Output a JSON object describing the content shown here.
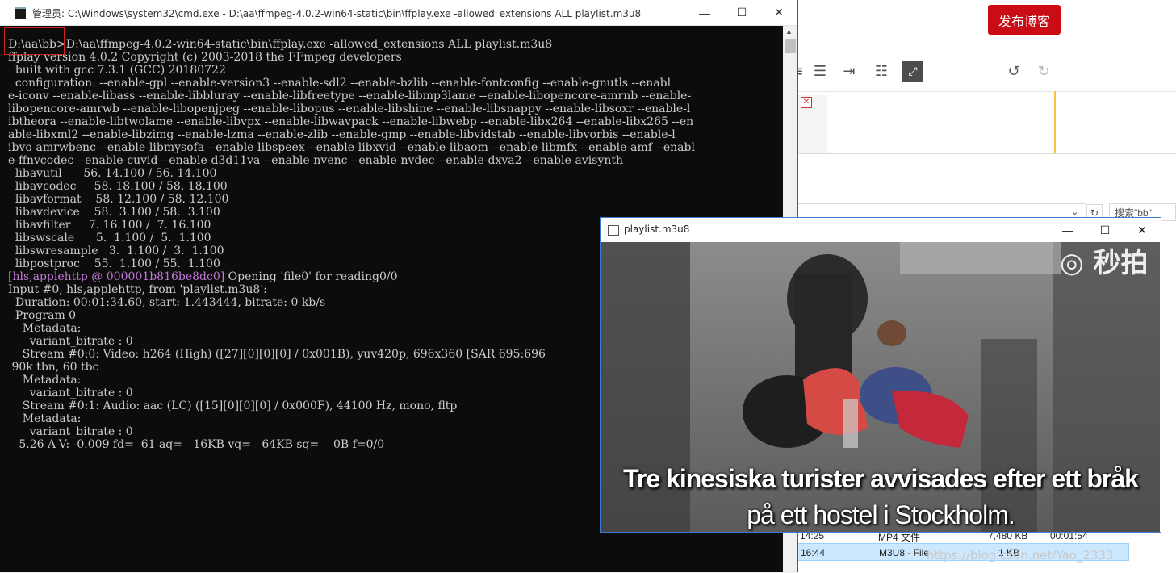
{
  "background_app": {
    "publish_button": "发布博客",
    "search_box": "搜索\"bb\"",
    "files": [
      {
        "time": "14:25",
        "type": "MP4 文件",
        "size": "7,480 KB",
        "duration": "00:01:54"
      },
      {
        "time": "16:44",
        "type": "M3U8 - File",
        "size": "1 KB",
        "duration": ""
      }
    ],
    "watermark": "https://blog.csdn.net/Yao_2333"
  },
  "cmd_window": {
    "title": "管理员: C:\\Windows\\system32\\cmd.exe - D:\\aa\\ffmpeg-4.0.2-win64-static\\bin\\ffplay.exe  -allowed_extensions ALL playlist.m3u8",
    "window_buttons": {
      "minimize": "—",
      "maximize": "☐",
      "close": "✕"
    },
    "lines": [
      "D:\\aa\\bb>D:\\aa\\ffmpeg-4.0.2-win64-static\\bin\\ffplay.exe -allowed_extensions ALL playlist.m3u8",
      "ffplay version 4.0.2 Copyright (c) 2003-2018 the FFmpeg developers",
      "  built with gcc 7.3.1 (GCC) 20180722",
      "  configuration: --enable-gpl --enable-version3 --enable-sdl2 --enable-bzlib --enable-fontconfig --enable-gnutls --enabl",
      "e-iconv --enable-libass --enable-libbluray --enable-libfreetype --enable-libmp3lame --enable-libopencore-amrnb --enable-",
      "libopencore-amrwb --enable-libopenjpeg --enable-libopus --enable-libshine --enable-libsnappy --enable-libsoxr --enable-l",
      "ibtheora --enable-libtwolame --enable-libvpx --enable-libwavpack --enable-libwebp --enable-libx264 --enable-libx265 --en",
      "able-libxml2 --enable-libzimg --enable-lzma --enable-zlib --enable-gmp --enable-libvidstab --enable-libvorbis --enable-l",
      "ibvo-amrwbenc --enable-libmysofa --enable-libspeex --enable-libxvid --enable-libaom --enable-libmfx --enable-amf --enabl",
      "e-ffnvcodec --enable-cuvid --enable-d3d11va --enable-nvenc --enable-nvdec --enable-dxva2 --enable-avisynth",
      "  libavutil      56. 14.100 / 56. 14.100",
      "  libavcodec     58. 18.100 / 58. 18.100",
      "  libavformat    58. 12.100 / 58. 12.100",
      "  libavdevice    58.  3.100 / 58.  3.100",
      "  libavfilter     7. 16.100 /  7. 16.100",
      "  libswscale      5.  1.100 /  5.  1.100",
      "  libswresample   3.  1.100 /  3.  1.100",
      "  libpostproc    55.  1.100 / 55.  1.100",
      "",
      "Input #0, hls,applehttp, from 'playlist.m3u8':",
      "  Duration: 00:01:34.60, start: 1.443444, bitrate: 0 kb/s",
      "  Program 0",
      "    Metadata:",
      "      variant_bitrate : 0",
      "    Stream #0:0: Video: h264 (High) ([27][0][0][0] / 0x001B), yuv420p, 696x360 [SAR 695:696",
      " 90k tbn, 60 tbc",
      "    Metadata:",
      "      variant_bitrate : 0",
      "    Stream #0:1: Audio: aac (LC) ([15][0][0][0] / 0x000F), 44100 Hz, mono, fltp",
      "    Metadata:",
      "      variant_bitrate : 0",
      "   5.26 A-V: -0.009 fd=  61 aq=   16KB vq=   64KB sq=    0B f=0/0"
    ],
    "hls_prefix": "[hls,applehttp @ 000001b816be8dc0]",
    "hls_suffix": " Opening 'file0' for reading0/0"
  },
  "ffplay_window": {
    "title": "playlist.m3u8",
    "window_buttons": {
      "minimize": "—",
      "maximize": "☐",
      "close": "✕"
    },
    "video": {
      "logo": "◎ 秒拍",
      "subtitle_line1": "Tre kinesiska turister avvisades efter ett bråk",
      "subtitle_line2": "på ett hostel i Stockholm."
    }
  }
}
